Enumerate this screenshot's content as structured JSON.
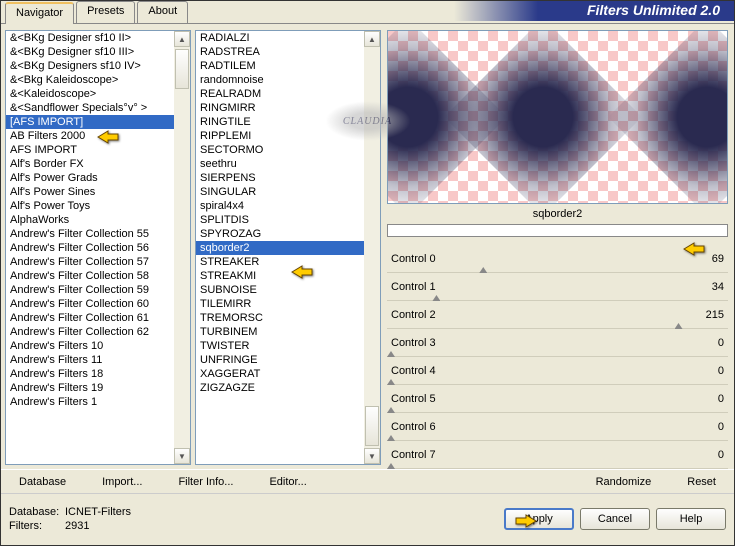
{
  "title": "Filters Unlimited 2.0",
  "tabs": [
    "Navigator",
    "Presets",
    "About"
  ],
  "active_tab": 0,
  "left_list": {
    "items": [
      "&<BKg Designer sf10 II>",
      "&<BKg Designer sf10 III>",
      "&<BKg Designers sf10 IV>",
      "&<Bkg Kaleidoscope>",
      "&<Kaleidoscope>",
      "&<Sandflower Specials°v° >",
      "[AFS IMPORT]",
      "AB Filters 2000",
      "AFS IMPORT",
      "Alf's Border FX",
      "Alf's Power Grads",
      "Alf's Power Sines",
      "Alf's Power Toys",
      "AlphaWorks",
      "Andrew's Filter Collection 55",
      "Andrew's Filter Collection 56",
      "Andrew's Filter Collection 57",
      "Andrew's Filter Collection 58",
      "Andrew's Filter Collection 59",
      "Andrew's Filter Collection 60",
      "Andrew's Filter Collection 61",
      "Andrew's Filter Collection 62",
      "Andrew's Filters 10",
      "Andrew's Filters 11",
      "Andrew's Filters 18",
      "Andrew's Filters 19",
      "Andrew's Filters 1"
    ],
    "selected": 6
  },
  "mid_list": {
    "items": [
      "RADIALZI",
      "RADSTREA",
      "RADTILEM",
      "randomnoise",
      "REALRADM",
      "RINGMIRR",
      "RINGTILE",
      "RIPPLEMI",
      "SECTORMO",
      "seethru",
      "SIERPENS",
      "SINGULAR",
      "spiral4x4",
      "SPLITDIS",
      "SPYROZAG",
      "sqborder2",
      "STREAKER",
      "STREAKMI",
      "SUBNOISE",
      "TILEMIRR",
      "TREMORSC",
      "TURBINEM",
      "TWISTER",
      "UNFRINGE",
      "XAGGERAT",
      "ZIGZAGZE"
    ],
    "selected": 15
  },
  "preview_label": "sqborder2",
  "controls": [
    {
      "label": "Control 0",
      "value": 69,
      "max": 255
    },
    {
      "label": "Control 1",
      "value": 34,
      "max": 255
    },
    {
      "label": "Control 2",
      "value": 215,
      "max": 255
    },
    {
      "label": "Control 3",
      "value": 0,
      "max": 255
    },
    {
      "label": "Control 4",
      "value": 0,
      "max": 255
    },
    {
      "label": "Control 5",
      "value": 0,
      "max": 255
    },
    {
      "label": "Control 6",
      "value": 0,
      "max": 255
    },
    {
      "label": "Control 7",
      "value": 0,
      "max": 255
    }
  ],
  "bottom_links": {
    "database": "Database",
    "import": "Import...",
    "filter_info": "Filter Info...",
    "editor": "Editor...",
    "randomize": "Randomize",
    "reset": "Reset"
  },
  "status": {
    "db_label": "Database:",
    "db_value": "ICNET-Filters",
    "filters_label": "Filters:",
    "filters_value": "2931"
  },
  "buttons": {
    "apply": "Apply",
    "cancel": "Cancel",
    "help": "Help"
  },
  "watermark": "CLAUDIA"
}
